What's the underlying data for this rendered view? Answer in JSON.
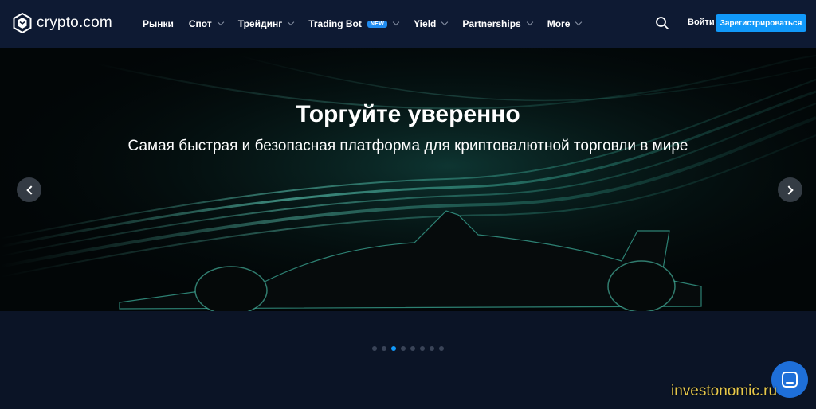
{
  "header": {
    "logo_text": "crypto.com",
    "nav": [
      {
        "label": "Рынки",
        "has_chevron": false
      },
      {
        "label": "Спот",
        "has_chevron": true
      },
      {
        "label": "Трейдинг",
        "has_chevron": true
      },
      {
        "label": "Trading Bot",
        "badge": "NEW",
        "has_chevron": true
      },
      {
        "label": "Yield",
        "has_chevron": true
      },
      {
        "label": "Partnerships",
        "has_chevron": true
      },
      {
        "label": "More",
        "has_chevron": true
      }
    ],
    "login_label": "Войти",
    "signup_label": "Зарегистрироваться",
    "search_icon": "search-icon"
  },
  "hero": {
    "title": "Торгуйте уверенно",
    "subtitle": "Самая быстрая и безопасная платформа для криптовалютной торговли в мире",
    "prev_icon": "chevron-left-icon",
    "next_icon": "chevron-right-icon"
  },
  "carousel": {
    "slide_count": 8,
    "active_index": 2
  },
  "chat_icon": "chat-icon",
  "watermark": "investonomic.ru",
  "colors": {
    "header_bg": "#0e1a33",
    "page_bg": "#0b1426",
    "accent": "#1199fa",
    "badge": "#1f8bf0",
    "watermark": "#e8c94a"
  }
}
